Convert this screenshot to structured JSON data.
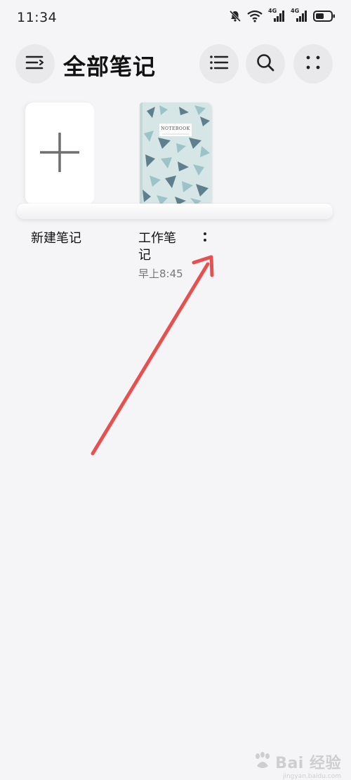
{
  "status_bar": {
    "time": "11:34",
    "icons": [
      "mute-bell-icon",
      "wifi-icon",
      "signal-4g-icon",
      "signal-4g-icon",
      "battery-icon"
    ],
    "network_label_1": "4G",
    "network_label_2": "4G"
  },
  "header": {
    "title": "全部笔记",
    "menu_icon": "menu-icon",
    "list_view_icon": "list-view-icon",
    "search_icon": "search-icon",
    "more_icon": "grid-dots-icon"
  },
  "notebooks": [
    {
      "label": "新建笔记",
      "type": "new",
      "icon": "plus-icon"
    },
    {
      "label": "工作笔记",
      "time": "早上8:45",
      "cover_title": "NOTEBOOK",
      "more_icon": "vertical-dots-icon"
    }
  ],
  "watermark": {
    "brand": "Bai 经验",
    "sub": "jingyan.baidu.com"
  },
  "colors": {
    "background": "#f5f5f7",
    "button_bg": "#e9e9ec",
    "arrow": "#e8504f",
    "cover_base": "#d6e6e6",
    "cover_dark": "#5f7f8c",
    "cover_mid": "#9cc4c8"
  }
}
